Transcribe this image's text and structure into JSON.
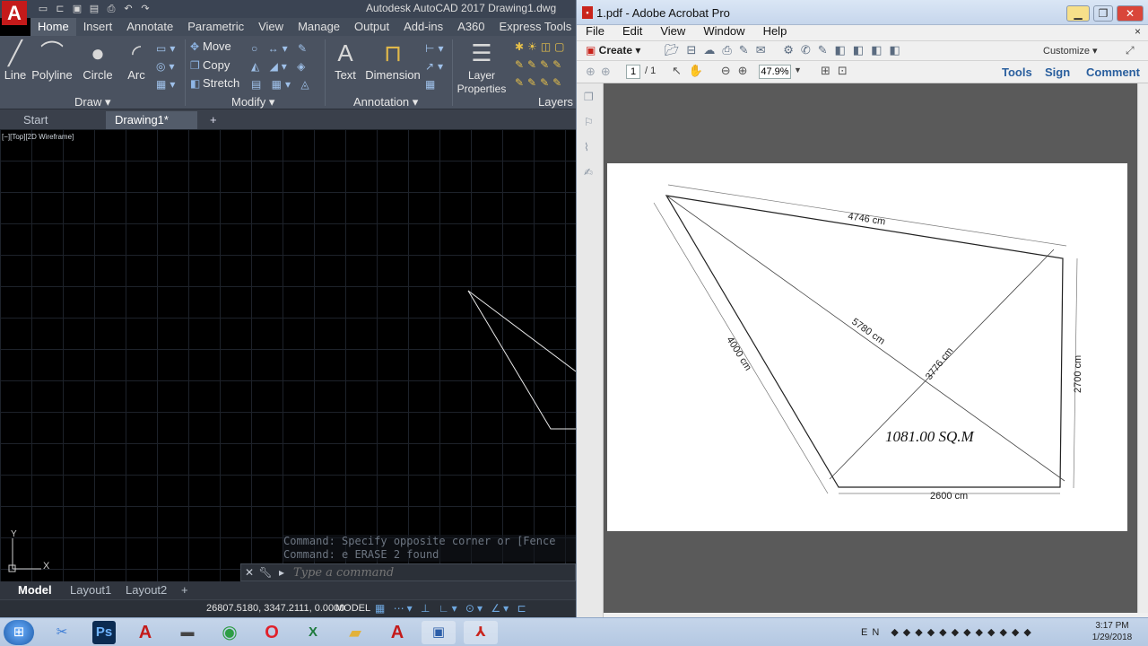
{
  "autocad": {
    "logo": "A",
    "title": "Autodesk AutoCAD 2017    Drawing1.dwg",
    "quick_access_icons": [
      "new-icon",
      "open-icon",
      "save-icon",
      "save-as-icon",
      "print-icon",
      "undo-icon",
      "redo-icon"
    ],
    "ribbon_tabs": [
      "Home",
      "Insert",
      "Annotate",
      "Parametric",
      "View",
      "Manage",
      "Output",
      "Add-ins",
      "A360",
      "Express Tools"
    ],
    "active_tab": "Home",
    "draw": {
      "line": "Line",
      "polyline": "Polyline",
      "circle": "Circle",
      "arc": "Arc",
      "panel": "Draw ▾"
    },
    "modify": {
      "move": "Move",
      "copy": "Copy",
      "stretch": "Stretch",
      "panel": "Modify ▾"
    },
    "annotation": {
      "text": "Text",
      "dimension": "Dimension",
      "panel": "Annotation ▾"
    },
    "layers": {
      "layer_properties": "Layer Properties",
      "panel": "Layers"
    },
    "file_tabs": {
      "start": "Start",
      "drawing": "Drawing1*",
      "close": "×",
      "add": "+"
    },
    "viewport_label": "[−][Top][2D Wireframe]",
    "ucs": {
      "y": "Y",
      "x": "X"
    },
    "command_history": [
      "Command: Specify opposite corner or [Fence",
      "Command: e ERASE 2 found"
    ],
    "command_placeholder": "Type a command",
    "layout_tabs": {
      "model": "Model",
      "layout1": "Layout1",
      "layout2": "Layout2",
      "add": "+"
    },
    "status": {
      "coords": "26807.5180, 3347.2111, 0.0000",
      "model": "MODEL"
    }
  },
  "acrobat": {
    "title": "1.pdf - Adobe Acrobat Pro",
    "menu": [
      "File",
      "Edit",
      "View",
      "Window",
      "Help"
    ],
    "close_doc": "×",
    "create": "Create ▾",
    "customize": "Customize ▾",
    "page_current": "1",
    "page_total": "/ 1",
    "zoom": "47.9%",
    "right_links": {
      "tools": "Tools",
      "sign": "Sign",
      "comment": "Comment"
    },
    "drawing": {
      "dim_top": "4746 cm",
      "dim_left": "4000 cm",
      "dim_diag1": "5780 cm",
      "dim_diag2": "3776 cm",
      "dim_right": "2700 cm",
      "dim_bottom": "2600 cm",
      "area": "1081.00 SQ.M"
    }
  },
  "taskbar": {
    "lang": "EN",
    "time": "3:17 PM",
    "date": "1/29/2018",
    "apps": [
      "photo-viewer-icon",
      "photoshop-icon",
      "autocad-icon",
      "window-icon",
      "chrome-icon",
      "opera-icon",
      "excel-icon",
      "explorer-icon",
      "autocad-icon",
      "media-icon",
      "acrobat-icon"
    ]
  },
  "colors": {
    "acad_red": "#c41a1a",
    "acro_red": "#c9241c",
    "link_blue": "#2a5f9e"
  }
}
